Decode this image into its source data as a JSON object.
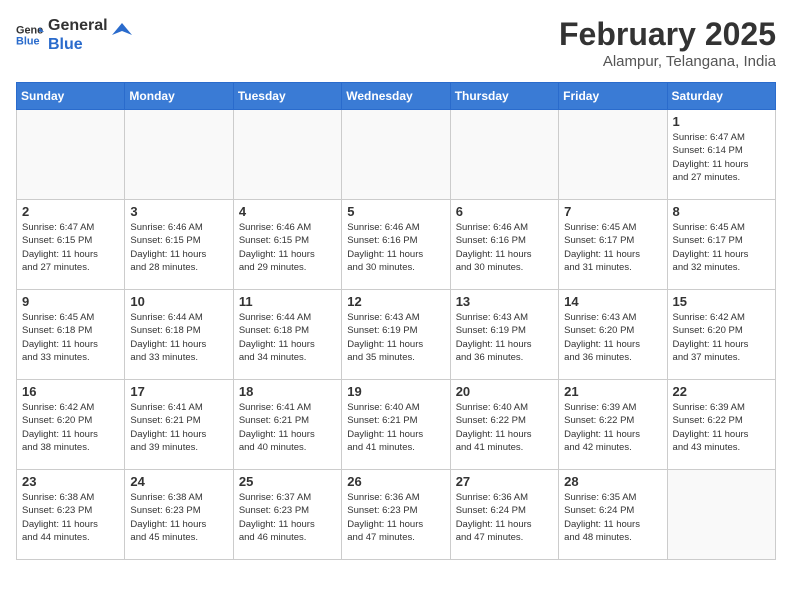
{
  "header": {
    "logo_general": "General",
    "logo_blue": "Blue",
    "title": "February 2025",
    "subtitle": "Alampur, Telangana, India"
  },
  "days_of_week": [
    "Sunday",
    "Monday",
    "Tuesday",
    "Wednesday",
    "Thursday",
    "Friday",
    "Saturday"
  ],
  "weeks": [
    [
      {
        "day": "",
        "info": ""
      },
      {
        "day": "",
        "info": ""
      },
      {
        "day": "",
        "info": ""
      },
      {
        "day": "",
        "info": ""
      },
      {
        "day": "",
        "info": ""
      },
      {
        "day": "",
        "info": ""
      },
      {
        "day": "1",
        "info": "Sunrise: 6:47 AM\nSunset: 6:14 PM\nDaylight: 11 hours\nand 27 minutes."
      }
    ],
    [
      {
        "day": "2",
        "info": "Sunrise: 6:47 AM\nSunset: 6:15 PM\nDaylight: 11 hours\nand 27 minutes."
      },
      {
        "day": "3",
        "info": "Sunrise: 6:46 AM\nSunset: 6:15 PM\nDaylight: 11 hours\nand 28 minutes."
      },
      {
        "day": "4",
        "info": "Sunrise: 6:46 AM\nSunset: 6:15 PM\nDaylight: 11 hours\nand 29 minutes."
      },
      {
        "day": "5",
        "info": "Sunrise: 6:46 AM\nSunset: 6:16 PM\nDaylight: 11 hours\nand 30 minutes."
      },
      {
        "day": "6",
        "info": "Sunrise: 6:46 AM\nSunset: 6:16 PM\nDaylight: 11 hours\nand 30 minutes."
      },
      {
        "day": "7",
        "info": "Sunrise: 6:45 AM\nSunset: 6:17 PM\nDaylight: 11 hours\nand 31 minutes."
      },
      {
        "day": "8",
        "info": "Sunrise: 6:45 AM\nSunset: 6:17 PM\nDaylight: 11 hours\nand 32 minutes."
      }
    ],
    [
      {
        "day": "9",
        "info": "Sunrise: 6:45 AM\nSunset: 6:18 PM\nDaylight: 11 hours\nand 33 minutes."
      },
      {
        "day": "10",
        "info": "Sunrise: 6:44 AM\nSunset: 6:18 PM\nDaylight: 11 hours\nand 33 minutes."
      },
      {
        "day": "11",
        "info": "Sunrise: 6:44 AM\nSunset: 6:18 PM\nDaylight: 11 hours\nand 34 minutes."
      },
      {
        "day": "12",
        "info": "Sunrise: 6:43 AM\nSunset: 6:19 PM\nDaylight: 11 hours\nand 35 minutes."
      },
      {
        "day": "13",
        "info": "Sunrise: 6:43 AM\nSunset: 6:19 PM\nDaylight: 11 hours\nand 36 minutes."
      },
      {
        "day": "14",
        "info": "Sunrise: 6:43 AM\nSunset: 6:20 PM\nDaylight: 11 hours\nand 36 minutes."
      },
      {
        "day": "15",
        "info": "Sunrise: 6:42 AM\nSunset: 6:20 PM\nDaylight: 11 hours\nand 37 minutes."
      }
    ],
    [
      {
        "day": "16",
        "info": "Sunrise: 6:42 AM\nSunset: 6:20 PM\nDaylight: 11 hours\nand 38 minutes."
      },
      {
        "day": "17",
        "info": "Sunrise: 6:41 AM\nSunset: 6:21 PM\nDaylight: 11 hours\nand 39 minutes."
      },
      {
        "day": "18",
        "info": "Sunrise: 6:41 AM\nSunset: 6:21 PM\nDaylight: 11 hours\nand 40 minutes."
      },
      {
        "day": "19",
        "info": "Sunrise: 6:40 AM\nSunset: 6:21 PM\nDaylight: 11 hours\nand 41 minutes."
      },
      {
        "day": "20",
        "info": "Sunrise: 6:40 AM\nSunset: 6:22 PM\nDaylight: 11 hours\nand 41 minutes."
      },
      {
        "day": "21",
        "info": "Sunrise: 6:39 AM\nSunset: 6:22 PM\nDaylight: 11 hours\nand 42 minutes."
      },
      {
        "day": "22",
        "info": "Sunrise: 6:39 AM\nSunset: 6:22 PM\nDaylight: 11 hours\nand 43 minutes."
      }
    ],
    [
      {
        "day": "23",
        "info": "Sunrise: 6:38 AM\nSunset: 6:23 PM\nDaylight: 11 hours\nand 44 minutes."
      },
      {
        "day": "24",
        "info": "Sunrise: 6:38 AM\nSunset: 6:23 PM\nDaylight: 11 hours\nand 45 minutes."
      },
      {
        "day": "25",
        "info": "Sunrise: 6:37 AM\nSunset: 6:23 PM\nDaylight: 11 hours\nand 46 minutes."
      },
      {
        "day": "26",
        "info": "Sunrise: 6:36 AM\nSunset: 6:23 PM\nDaylight: 11 hours\nand 47 minutes."
      },
      {
        "day": "27",
        "info": "Sunrise: 6:36 AM\nSunset: 6:24 PM\nDaylight: 11 hours\nand 47 minutes."
      },
      {
        "day": "28",
        "info": "Sunrise: 6:35 AM\nSunset: 6:24 PM\nDaylight: 11 hours\nand 48 minutes."
      },
      {
        "day": "",
        "info": ""
      }
    ]
  ]
}
